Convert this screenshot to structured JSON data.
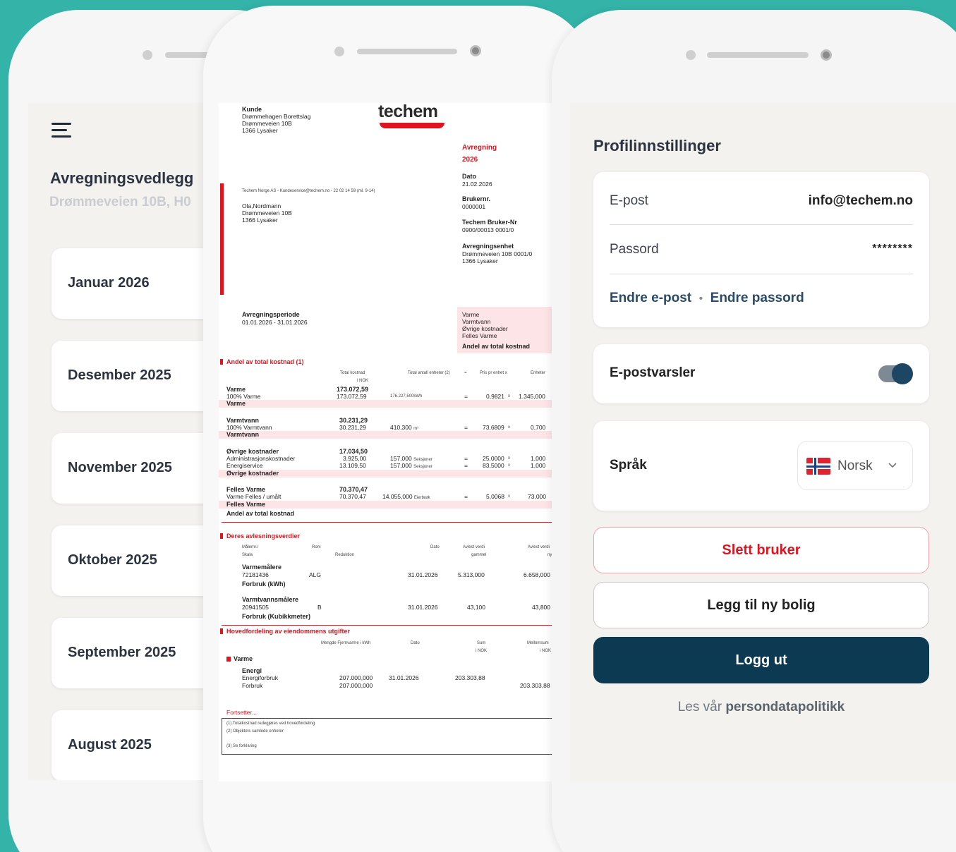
{
  "left_screen": {
    "title": "Avregningsvedlegg",
    "subtitle": "Drømmeveien 10B, H0",
    "months": [
      "Januar 2026",
      "Desember 2025",
      "November 2025",
      "Oktober 2025",
      "September 2025",
      "August 2025"
    ]
  },
  "document": {
    "logo": "techem",
    "customer_label": "Kunde",
    "customer_lines": [
      "Drømmehagen Borettslag",
      "Drømmeveien 10B",
      "1366 Lysaker"
    ],
    "sender_line": "Techem Norge AS - Kundeservice@techem.no - 22 02 14 59 (ml. 9-14)",
    "recipient_lines": [
      "Ola,Nordmann",
      "Drømmeveien 10B",
      "1366 Lysaker"
    ],
    "heading": "Avregning",
    "year": "2026",
    "date_label": "Dato",
    "date_value": "21.02.2026",
    "userno_label": "Brukernr.",
    "userno_value": "0000001",
    "techem_no_label": "Techem Bruker-Nr",
    "techem_no_value": "0900/00013 0001/0",
    "unit_label": "Avregningsenhet",
    "unit_lines": [
      "Drømmeveien 10B 0001/0",
      "1366 Lysaker"
    ],
    "period_label": "Avregningsperiode",
    "period_value": "01.01.2026 - 31.01.2026",
    "summary_lines": [
      "Varme",
      "Varmtvann",
      "Øvrige kostnader",
      "Felles Varme"
    ],
    "summary_total": "Andel av total kostnad",
    "section1_title": "Andel av total kostnad (1)",
    "section1_headers": [
      "Total kostnad",
      "i NOK",
      "Total antall enheter (2)",
      "=",
      "Pris pr enhet x",
      "Enheter"
    ],
    "groups": [
      {
        "name": "Varme",
        "total": "173.072,59",
        "sub": "100%  Varme",
        "sub_val": "173.072,59",
        "units": "176.227,500",
        "unit_sfx": "kWh",
        "eq": "=",
        "price": "0,9821",
        "x": "x",
        "qty": "1.345,000",
        "footer": "Varme"
      },
      {
        "name": "Varmtvann",
        "total": "30.231,29",
        "sub": "100%  Varmtvann",
        "sub_val": "30.231,29",
        "units": "410,300",
        "unit_sfx": "m³",
        "eq": "=",
        "price": "73,6809",
        "x": "x",
        "qty": "0,700",
        "footer": "Varmtvann"
      },
      {
        "name": "Øvrige kostnader",
        "total": "17.034,50",
        "sub": "Administrasjonskostnader",
        "sub_val": "3.925,00",
        "units": "157,000",
        "unit_sfx": "Seksjoner",
        "eq": "=",
        "price": "25,0000",
        "x": "x",
        "qty": "1,000",
        "sub2": "Energiservice",
        "sub2_val": "13.109,50",
        "units2": "157,000",
        "unit_sfx2": "Seksjoner",
        "eq2": "=",
        "price2": "83,5000",
        "x2": "x",
        "qty2": "1,000",
        "footer": "Øvrige kostnader"
      },
      {
        "name": "Felles Varme",
        "total": "70.370,47",
        "sub": "Varme Felles / umålt",
        "sub_val": "70.370,47",
        "units": "14.055,000",
        "unit_sfx": "Eierbrøk",
        "eq": "=",
        "price": "5,0068",
        "x": "x",
        "qty": "73,000",
        "footer": "Felles Varme"
      }
    ],
    "group_total": "Andel av total kostnad",
    "section2_title": "Deres avlesningsverdier",
    "section2_headers": [
      "Målernr./",
      "Skala",
      "Rom",
      "Reduktion",
      "Dato",
      "Avlest verdi",
      "gammel",
      "Avlest verdi",
      "ny"
    ],
    "meters": [
      {
        "name": "Varmemålere",
        "no": "72181436",
        "room": "ALG",
        "date": "31.01.2026",
        "old": "5.313,000",
        "new": "6.658,000",
        "usage": "Forbruk (kWh)"
      },
      {
        "name": "Varmtvannsmålere",
        "no": "20941505",
        "room": "B",
        "date": "31.01.2026",
        "old": "43,100",
        "new": "43,800",
        "usage": "Forbruk (Kubikkmeter)"
      }
    ],
    "section3_title": "Hovedfordeling av eiendommens utgifter",
    "section3_headers": [
      "Mengde Fjernvarme i kWh",
      "Dato",
      "Sum",
      "i NOK",
      "Mellomsum",
      "i NOK"
    ],
    "s3_group": "Varme",
    "s3_sub": "Energi",
    "s3_row1": {
      "label": "Energiforbruk",
      "qty": "207.000,000",
      "date": "31.01.2026",
      "sum": "203.303,88"
    },
    "s3_row2": {
      "label": "Forbruk",
      "qty": "207.000,000",
      "mid": "203.303,88"
    },
    "continues": "Fortsetter...",
    "notes": [
      "(1)  Totalkostnad redegjøres ved hovedfordeling",
      "(2)  Objektets samlede enheter",
      "(3)  Se forklaring"
    ]
  },
  "profile": {
    "title": "Profilinnstillinger",
    "email_label": "E-post",
    "email_value": "info@techem.no",
    "password_label": "Passord",
    "password_value": "********",
    "change_email": "Endre e-post",
    "separator": "•",
    "change_password": "Endre passord",
    "notifications_label": "E-postvarsler",
    "notifications_on": true,
    "language_label": "Språk",
    "language_value": "Norsk",
    "delete_button": "Slett bruker",
    "add_button": "Legg til ny bolig",
    "logout_button": "Logg ut",
    "policy_prefix": "Les vår",
    "policy_link": "persondatapolitikk"
  },
  "colors": {
    "background": "#34b3a8",
    "accent_red": "#e0141e",
    "dark_blue": "#0c3a52"
  }
}
